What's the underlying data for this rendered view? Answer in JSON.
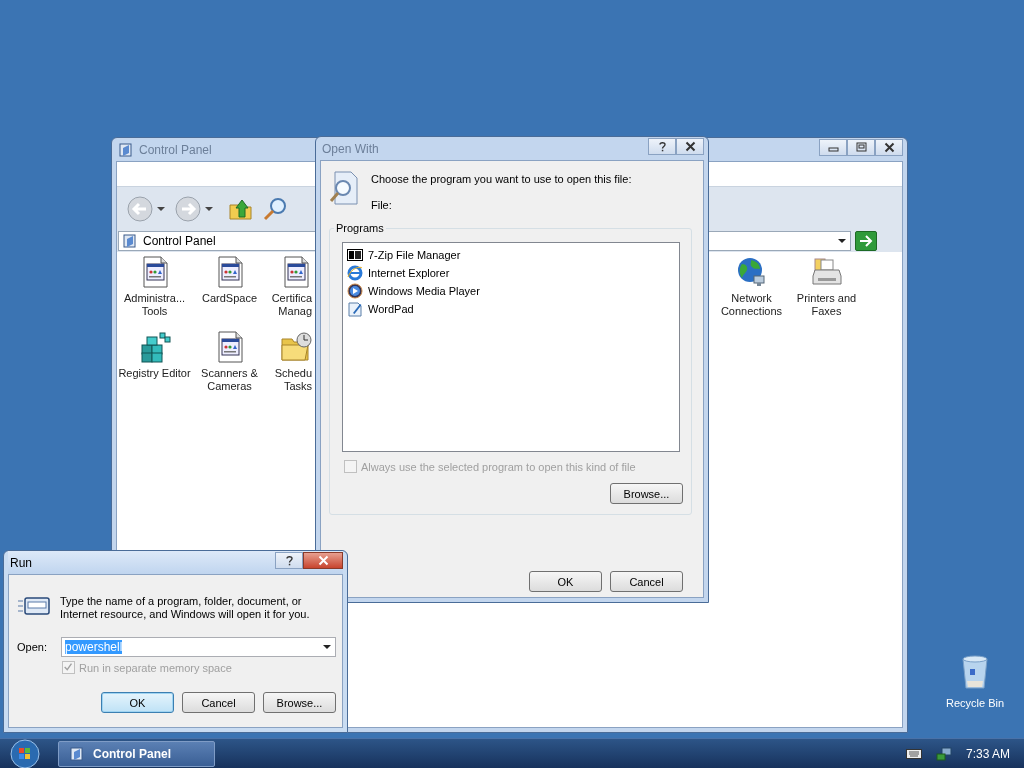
{
  "control_panel": {
    "title": "Control Panel",
    "active": false,
    "address": "Control Panel",
    "items_left": [
      {
        "label": "Administra... Tools",
        "kind": "applet"
      },
      {
        "label": "CardSpace",
        "kind": "applet"
      },
      {
        "label": "Certifica Manag",
        "kind": "applet"
      },
      {
        "label": "Registry Editor",
        "kind": "registry"
      },
      {
        "label": "Scanners & Cameras",
        "kind": "applet"
      },
      {
        "label": "Schedu Tasks",
        "kind": "scheduler"
      }
    ],
    "items_right": [
      {
        "label": "Network Connections",
        "kind": "network"
      },
      {
        "label": "Printers and Faxes",
        "kind": "printer"
      }
    ]
  },
  "open_with": {
    "title": "Open With",
    "active": false,
    "prompt": "Choose the program you want to use to open this file:",
    "file_label": "File:",
    "group_label": "Programs",
    "programs": [
      {
        "name": "7-Zip File Manager",
        "kind": "archive"
      },
      {
        "name": "Internet Explorer",
        "kind": "browser"
      },
      {
        "name": "Windows Media Player",
        "kind": "media"
      },
      {
        "name": "WordPad",
        "kind": "editor"
      }
    ],
    "always_use": {
      "label": "Always use the selected program to open this kind of file",
      "checked": false,
      "disabled": true
    },
    "browse_button": "Browse...",
    "buttons": [
      {
        "label": "OK",
        "focused": false
      },
      {
        "label": "Cancel",
        "focused": false
      }
    ]
  },
  "run": {
    "title": "Run",
    "active": true,
    "description": "Type the name of a program, folder, document, or Internet resource, and Windows will open it for you.",
    "open_label": "Open:",
    "value": "powershell",
    "value_selected": true,
    "separate_memory": {
      "label": "Run in separate memory space",
      "checked": true,
      "disabled": true
    },
    "buttons": [
      {
        "label": "OK",
        "focused": true
      },
      {
        "label": "Cancel",
        "focused": false
      },
      {
        "label": "Browse...",
        "focused": false
      }
    ]
  },
  "desktop_icons": [
    {
      "label": "Recycle Bin"
    }
  ],
  "taskbar": {
    "buttons": [
      {
        "label": "Control Panel"
      }
    ],
    "clock": "7:33 AM"
  }
}
